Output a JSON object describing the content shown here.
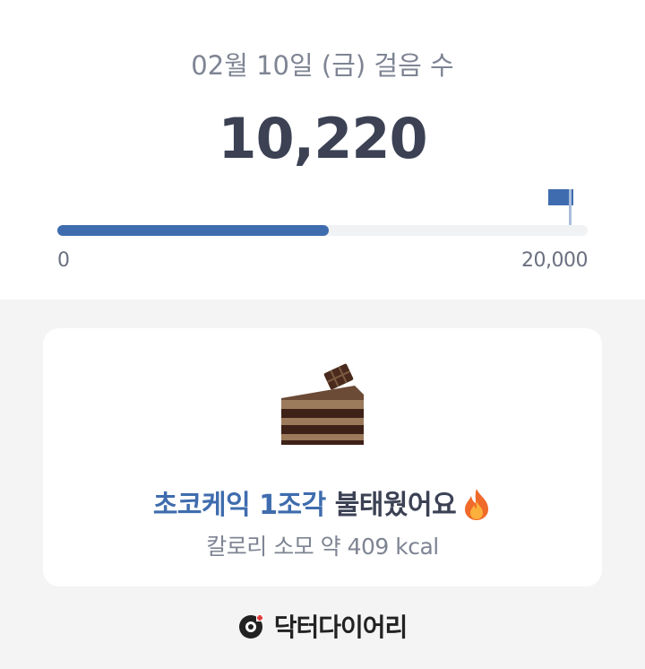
{
  "header": {
    "date_label": "02월 10일 (금) 걸음 수",
    "step_count": "10,220"
  },
  "progress": {
    "value": 10220,
    "goal": 20000,
    "fraction": 0.511,
    "min_label": "0",
    "max_label": "20,000",
    "fill_color": "#3f6cae",
    "goal_icon": "flag-icon"
  },
  "calorie_card": {
    "image": "chocolate-cake-icon",
    "food_text": "초코케익 1조각",
    "burn_text": "불태웠어요",
    "burn_icon": "fire-icon",
    "calorie_text": "칼로리 소모 약 409 kcal"
  },
  "footer": {
    "brand_name": "닥터다이어리",
    "brand_icon": "doctor-diary-logo-icon"
  }
}
